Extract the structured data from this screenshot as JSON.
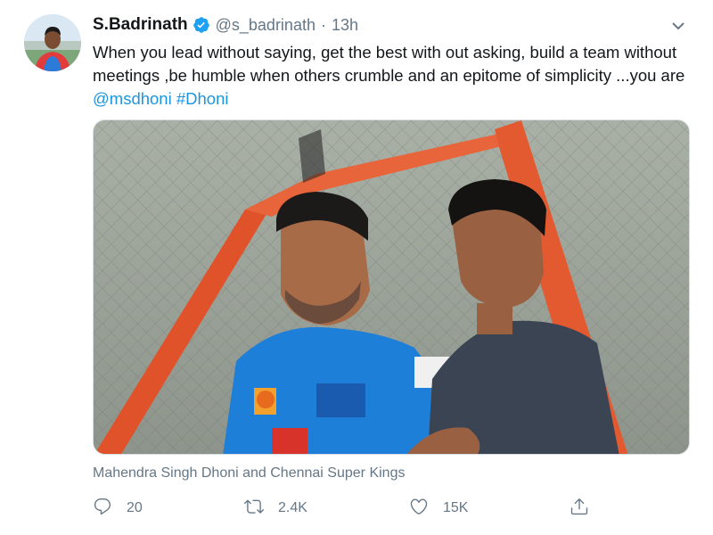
{
  "tweet": {
    "display_name": "S.Badrinath",
    "handle": "@s_badrinath",
    "separator": "·",
    "time": "13h",
    "text_part1": "When you lead without saying, get the best with out  asking, build a team without meetings ,be humble when others crumble and an epitome of simplicity ...you are ",
    "mention": "@msdhoni",
    "hashtag": "#Dhoni",
    "media_caption": "Mahendra Singh Dhoni and Chennai Super Kings"
  },
  "actions": {
    "reply_count": "20",
    "retweet_count": "2.4K",
    "like_count": "15K"
  },
  "icons": {
    "verified": "verified-badge-icon",
    "caret": "chevron-down-icon",
    "reply": "reply-icon",
    "retweet": "retweet-icon",
    "like": "heart-icon",
    "share": "share-icon"
  },
  "colors": {
    "link": "#1b95e0",
    "muted": "#657786",
    "verified": "#1da1f2"
  }
}
